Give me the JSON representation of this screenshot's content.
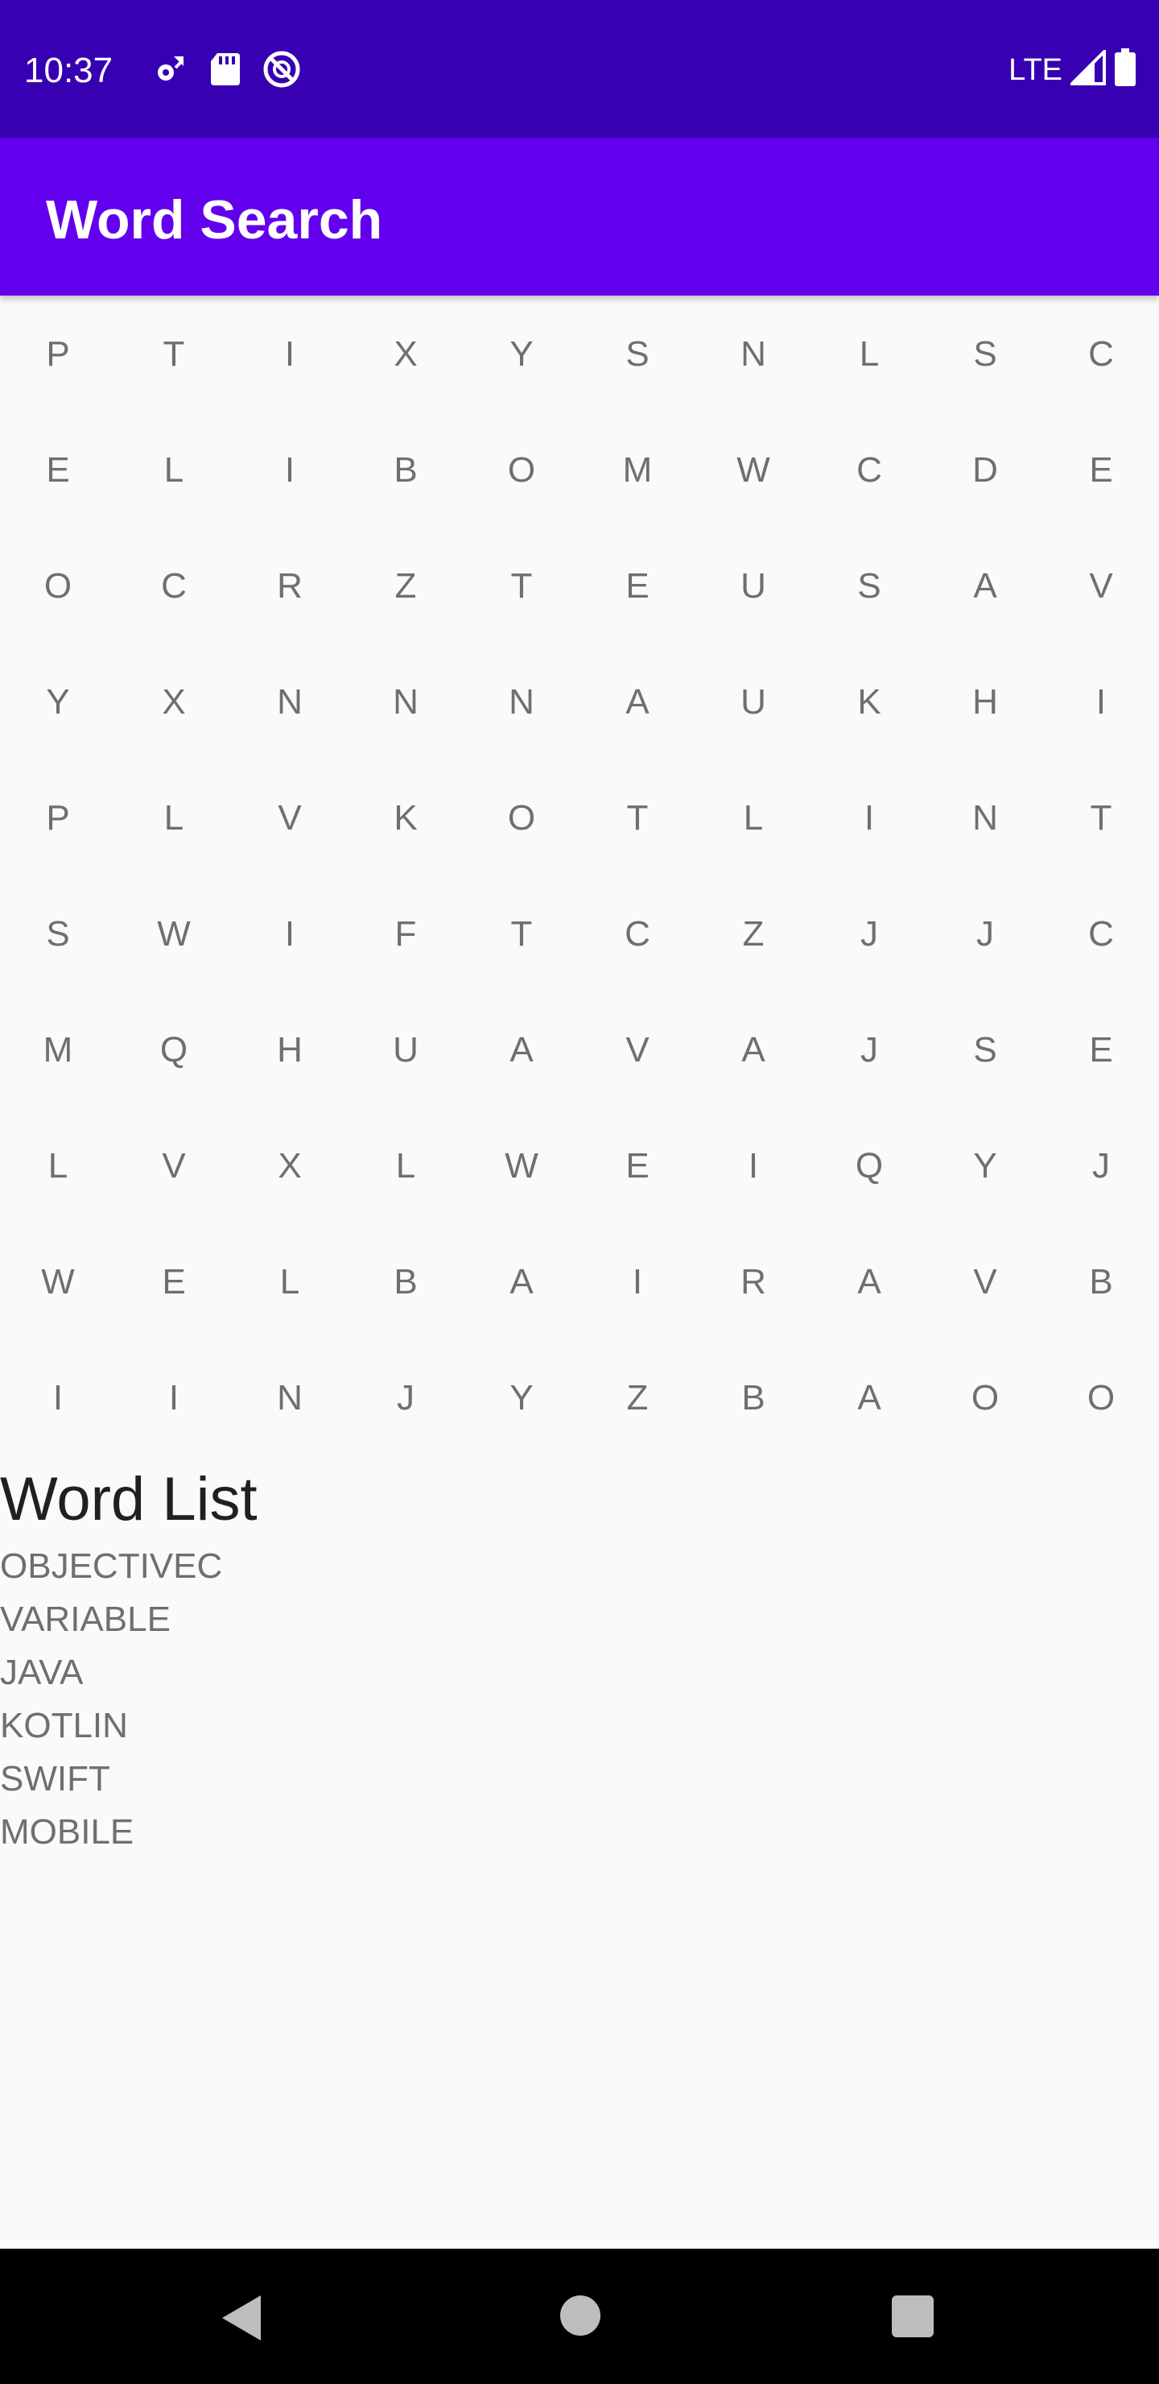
{
  "status_bar": {
    "time": "10:37",
    "network": "LTE",
    "icons_left": [
      "settings-sync-icon",
      "sd-card-icon",
      "do-not-disturb-icon"
    ],
    "icons_right": [
      "signal-icon",
      "battery-icon"
    ],
    "background": "#3700b3"
  },
  "app_bar": {
    "title": "Word Search",
    "background": "#6200ee"
  },
  "grid": {
    "rows": [
      [
        "P",
        "T",
        "I",
        "X",
        "Y",
        "S",
        "N",
        "L",
        "S",
        "C"
      ],
      [
        "E",
        "L",
        "I",
        "B",
        "O",
        "M",
        "W",
        "C",
        "D",
        "E"
      ],
      [
        "O",
        "C",
        "R",
        "Z",
        "T",
        "E",
        "U",
        "S",
        "A",
        "V"
      ],
      [
        "Y",
        "X",
        "N",
        "N",
        "N",
        "A",
        "U",
        "K",
        "H",
        "I"
      ],
      [
        "P",
        "L",
        "V",
        "K",
        "O",
        "T",
        "L",
        "I",
        "N",
        "T"
      ],
      [
        "S",
        "W",
        "I",
        "F",
        "T",
        "C",
        "Z",
        "J",
        "J",
        "C"
      ],
      [
        "M",
        "Q",
        "H",
        "U",
        "A",
        "V",
        "A",
        "J",
        "S",
        "E"
      ],
      [
        "L",
        "V",
        "X",
        "L",
        "W",
        "E",
        "I",
        "Q",
        "Y",
        "J"
      ],
      [
        "W",
        "E",
        "L",
        "B",
        "A",
        "I",
        "R",
        "A",
        "V",
        "B"
      ],
      [
        "I",
        "I",
        "N",
        "J",
        "Y",
        "Z",
        "B",
        "A",
        "O",
        "O"
      ]
    ]
  },
  "word_list": {
    "title": "Word List",
    "words": [
      "OBJECTIVEC",
      "VARIABLE",
      "JAVA",
      "KOTLIN",
      "SWIFT",
      "MOBILE"
    ]
  },
  "nav_bar": {
    "icons": [
      "back-icon",
      "home-icon",
      "recents-icon"
    ]
  }
}
